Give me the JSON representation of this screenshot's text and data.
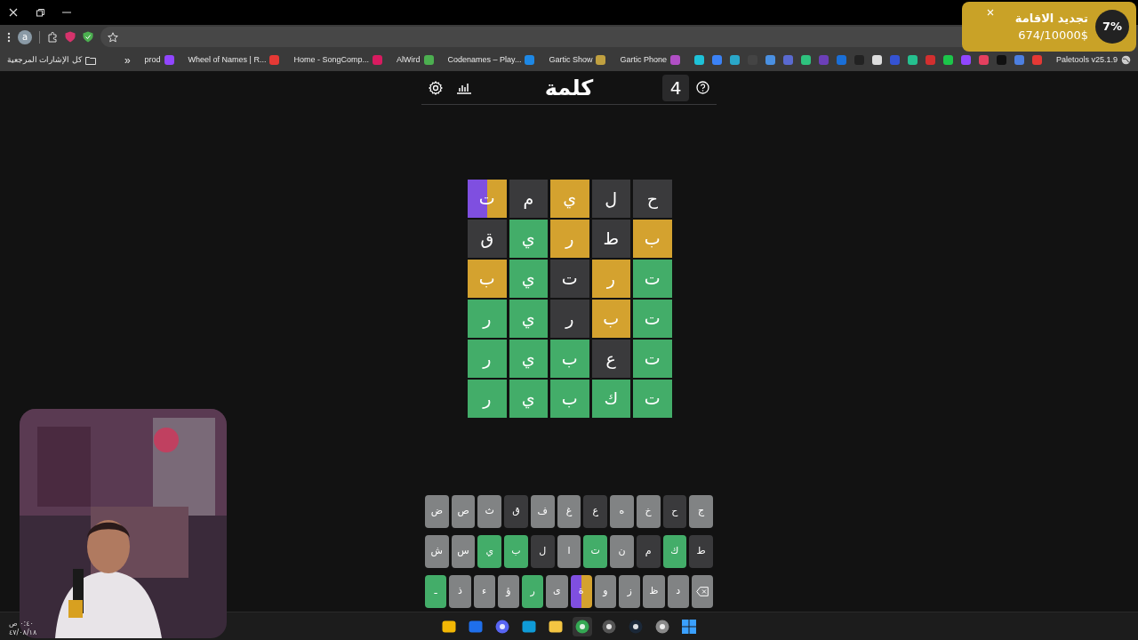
{
  "browser": {
    "profile_initial": "a"
  },
  "bookmarks": {
    "extension_label": "Paletools v25.1.9",
    "items": [
      {
        "label": "Gartic Phone",
        "color": "#b14fc5"
      },
      {
        "label": "Gartic Show",
        "color": "#c0a040"
      },
      {
        "label": "Codenames – Play...",
        "color": "#1e88e5"
      },
      {
        "label": "AlWird",
        "color": "#4caf50"
      },
      {
        "label": "Home - SongComp...",
        "color": "#d81b60"
      },
      {
        "label": "Wheel of Names | R...",
        "color": "#e53935"
      },
      {
        "label": "prod",
        "color": "#9146ff"
      }
    ],
    "overflow": "«",
    "all_bookmarks": "كل الإشارات المرجعية"
  },
  "notification": {
    "title": "تجديد الاقامة",
    "amount": "674/10000$",
    "percent": "7%"
  },
  "game": {
    "title": "كلمة",
    "streak": "4",
    "board": [
      [
        {
          "letter": "ح",
          "color": "#3a3a3c"
        },
        {
          "letter": "ل",
          "color": "#3a3a3c"
        },
        {
          "letter": "ي",
          "color": "#d4a22f"
        },
        {
          "letter": "م",
          "color": "#3a3a3c"
        },
        {
          "letter": "ت",
          "color": "#d4a22f",
          "kind": "split"
        }
      ],
      [
        {
          "letter": "ب",
          "color": "#d4a22f"
        },
        {
          "letter": "ط",
          "color": "#3a3a3c"
        },
        {
          "letter": "ر",
          "color": "#d4a22f"
        },
        {
          "letter": "ي",
          "color": "#43ad69"
        },
        {
          "letter": "ق",
          "color": "#3a3a3c"
        }
      ],
      [
        {
          "letter": "ت",
          "color": "#43ad69"
        },
        {
          "letter": "ر",
          "color": "#d4a22f"
        },
        {
          "letter": "ت",
          "color": "#3a3a3c"
        },
        {
          "letter": "ي",
          "color": "#43ad69"
        },
        {
          "letter": "ب",
          "color": "#d4a22f"
        }
      ],
      [
        {
          "letter": "ت",
          "color": "#43ad69"
        },
        {
          "letter": "ب",
          "color": "#d4a22f"
        },
        {
          "letter": "ر",
          "color": "#3a3a3c"
        },
        {
          "letter": "ي",
          "color": "#43ad69"
        },
        {
          "letter": "ر",
          "color": "#43ad69"
        }
      ],
      [
        {
          "letter": "ت",
          "color": "#43ad69"
        },
        {
          "letter": "ع",
          "color": "#3a3a3c"
        },
        {
          "letter": "ب",
          "color": "#43ad69"
        },
        {
          "letter": "ي",
          "color": "#43ad69"
        },
        {
          "letter": "ر",
          "color": "#43ad69"
        }
      ],
      [
        {
          "letter": "ت",
          "color": "#43ad69"
        },
        {
          "letter": "ك",
          "color": "#43ad69"
        },
        {
          "letter": "ب",
          "color": "#43ad69"
        },
        {
          "letter": "ي",
          "color": "#43ad69"
        },
        {
          "letter": "ر",
          "color": "#43ad69"
        }
      ]
    ],
    "keyboard": [
      [
        {
          "kind": "letter",
          "label": "ج",
          "color": "#818384"
        },
        {
          "kind": "letter",
          "label": "ح",
          "color": "#3a3a3c"
        },
        {
          "kind": "letter",
          "label": "خ",
          "color": "#818384"
        },
        {
          "kind": "letter",
          "label": "ه",
          "color": "#818384"
        },
        {
          "kind": "letter",
          "label": "ع",
          "color": "#3a3a3c"
        },
        {
          "kind": "letter",
          "label": "غ",
          "color": "#818384"
        },
        {
          "kind": "letter",
          "label": "ف",
          "color": "#818384"
        },
        {
          "kind": "letter",
          "label": "ق",
          "color": "#3a3a3c"
        },
        {
          "kind": "letter",
          "label": "ث",
          "color": "#818384"
        },
        {
          "kind": "letter",
          "label": "ص",
          "color": "#818384"
        },
        {
          "kind": "letter",
          "label": "ض",
          "color": "#818384"
        }
      ],
      [
        {
          "kind": "letter",
          "label": "ط",
          "color": "#3a3a3c"
        },
        {
          "kind": "letter",
          "label": "ك",
          "color": "#43ad69"
        },
        {
          "kind": "letter",
          "label": "م",
          "color": "#3a3a3c"
        },
        {
          "kind": "letter",
          "label": "ن",
          "color": "#818384"
        },
        {
          "kind": "letter",
          "label": "ت",
          "color": "#43ad69"
        },
        {
          "kind": "letter",
          "label": "ا",
          "color": "#818384"
        },
        {
          "kind": "letter",
          "label": "ل",
          "color": "#3a3a3c"
        },
        {
          "kind": "letter",
          "label": "ب",
          "color": "#43ad69"
        },
        {
          "kind": "letter",
          "label": "ي",
          "color": "#43ad69"
        },
        {
          "kind": "letter",
          "label": "س",
          "color": "#818384"
        },
        {
          "kind": "letter",
          "label": "ش",
          "color": "#818384"
        }
      ],
      [
        {
          "kind": "backspace",
          "color": "#818384"
        },
        {
          "kind": "letter",
          "label": "د",
          "color": "#818384"
        },
        {
          "kind": "letter",
          "label": "ظ",
          "color": "#818384"
        },
        {
          "kind": "letter",
          "label": "ز",
          "color": "#818384"
        },
        {
          "kind": "letter",
          "label": "و",
          "color": "#818384"
        },
        {
          "kind": "split",
          "label": "ة",
          "color": "#d4a22f"
        },
        {
          "kind": "letter",
          "label": "ى",
          "color": "#818384"
        },
        {
          "kind": "letter",
          "label": "ر",
          "color": "#43ad69"
        },
        {
          "kind": "letter",
          "label": "ؤ",
          "color": "#818384"
        },
        {
          "kind": "letter",
          "label": "ء",
          "color": "#818384"
        },
        {
          "kind": "letter",
          "label": "ذ",
          "color": "#818384"
        },
        {
          "kind": "letter",
          "label": "ـ",
          "color": "#43ad69"
        }
      ]
    ]
  },
  "taskbar": {
    "time": "٠:٤٠ ص",
    "date": "٤٧/٠٨/١٨"
  }
}
